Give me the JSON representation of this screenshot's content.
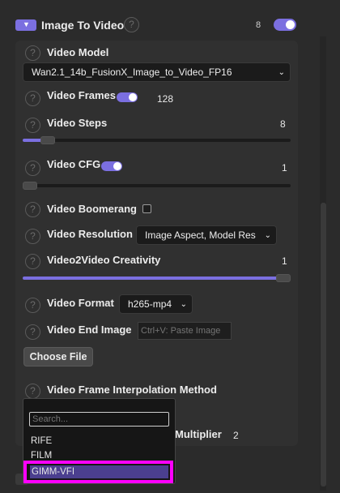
{
  "header": {
    "title": "Image To Video",
    "count": "8",
    "enabled": true,
    "collapse_icon": "chevron-down-icon",
    "help_icon": "question-icon"
  },
  "fields": {
    "video_model": {
      "label": "Video Model",
      "value": "Wan2.1_14b_FusionX_Image_to_Video_FP16"
    },
    "video_frames": {
      "label": "Video Frames",
      "enabled": true,
      "value": "128"
    },
    "video_steps": {
      "label": "Video Steps",
      "value": "8",
      "fill_fraction": 0.07
    },
    "video_cfg": {
      "label": "Video CFG",
      "enabled": true,
      "value": "1",
      "fill_fraction": 0.0
    },
    "video_boomerang": {
      "label": "Video Boomerang",
      "checked": false
    },
    "video_resolution": {
      "label": "Video Resolution",
      "value": "Image Aspect, Model Res"
    },
    "video2video_creativity": {
      "label": "Video2Video Creativity",
      "value": "1",
      "fill_fraction": 1.0
    },
    "video_format": {
      "label": "Video Format",
      "value": "h265-mp4"
    },
    "video_end_image": {
      "label": "Video End Image",
      "placeholder": "Ctrl+V: Paste Image",
      "choose_file": "Choose File"
    },
    "video_frame_interpolation": {
      "label": "Video Frame Interpolation Method"
    },
    "interp_multiplier": {
      "label": "Multiplier",
      "value": "2"
    }
  },
  "dropdown": {
    "search_placeholder": "Search...",
    "options": [
      "RIFE",
      "FILM",
      "GIMM-VFI"
    ],
    "highlighted": "GIMM-VFI"
  },
  "colors": {
    "accent": "#7b6fe0",
    "highlight_border": "#ff00ff",
    "highlight_bg": "#4b3f8f"
  }
}
